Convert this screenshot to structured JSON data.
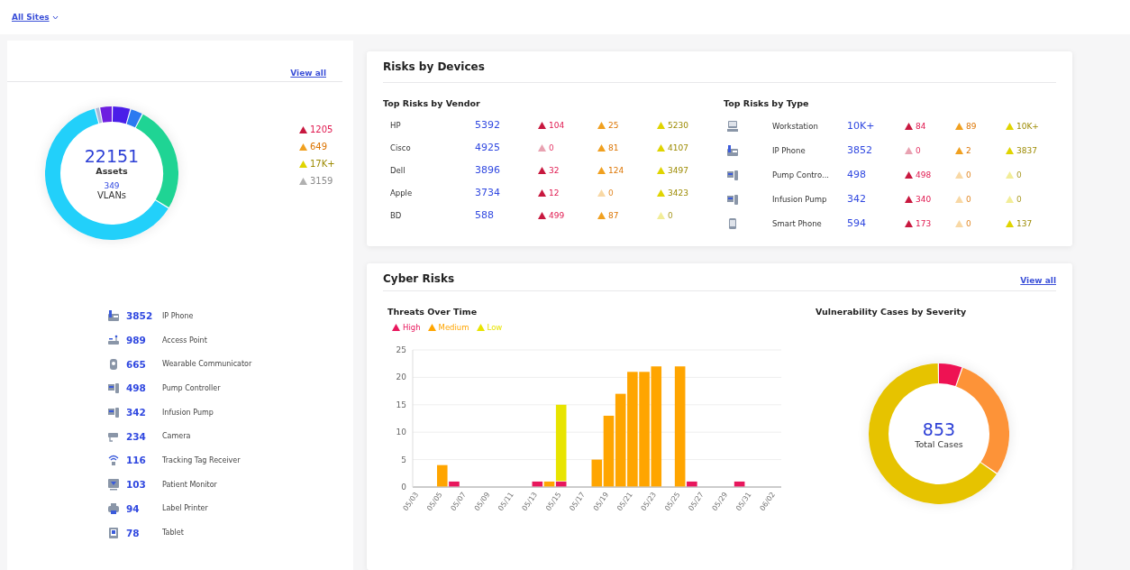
{
  "top_bar": {
    "site_filter": "All Sites"
  },
  "assets": {
    "view_all": "View all",
    "total": "22151",
    "total_label": "Assets",
    "vlans": "349",
    "vlans_label": "VLANs",
    "risks": [
      {
        "kind": "high",
        "count": "1205"
      },
      {
        "kind": "medium",
        "count": "649"
      },
      {
        "kind": "low",
        "count": "17K+"
      },
      {
        "kind": "none",
        "count": "3159"
      }
    ],
    "devices": [
      {
        "kind": "ip-phone",
        "count": "3852",
        "name": "IP Phone"
      },
      {
        "kind": "access-point",
        "count": "989",
        "name": "Access Point"
      },
      {
        "kind": "wearable",
        "count": "665",
        "name": "Wearable Communicator"
      },
      {
        "kind": "pump",
        "count": "498",
        "name": "Pump Controller"
      },
      {
        "kind": "pump",
        "count": "342",
        "name": "Infusion Pump"
      },
      {
        "kind": "camera",
        "count": "234",
        "name": "Camera"
      },
      {
        "kind": "tracking-tag",
        "count": "116",
        "name": "Tracking Tag Receiver"
      },
      {
        "kind": "patient-monitor",
        "count": "103",
        "name": "Patient Monitor"
      },
      {
        "kind": "label-printer",
        "count": "94",
        "name": "Label Printer"
      },
      {
        "kind": "tablet",
        "count": "78",
        "name": "Tablet"
      }
    ]
  },
  "risks_by_devices": {
    "title": "Risks by Devices",
    "vendor_table": {
      "title": "Top Risks by Vendor",
      "rows": [
        {
          "name": "HP",
          "count": "5392",
          "risks": [
            {
              "kind": "high",
              "count": "104",
              "faded": false
            },
            {
              "kind": "medium",
              "count": "25",
              "faded": false
            },
            {
              "kind": "low",
              "count": "5230",
              "faded": false
            }
          ]
        },
        {
          "name": "Cisco",
          "count": "4925",
          "risks": [
            {
              "kind": "high",
              "count": "0",
              "faded": true
            },
            {
              "kind": "medium",
              "count": "81",
              "faded": false
            },
            {
              "kind": "low",
              "count": "4107",
              "faded": false
            }
          ]
        },
        {
          "name": "Dell",
          "count": "3896",
          "risks": [
            {
              "kind": "high",
              "count": "32",
              "faded": false
            },
            {
              "kind": "medium",
              "count": "124",
              "faded": false
            },
            {
              "kind": "low",
              "count": "3497",
              "faded": false
            }
          ]
        },
        {
          "name": "Apple",
          "count": "3734",
          "risks": [
            {
              "kind": "high",
              "count": "12",
              "faded": false
            },
            {
              "kind": "medium",
              "count": "0",
              "faded": true
            },
            {
              "kind": "low",
              "count": "3423",
              "faded": false
            }
          ]
        },
        {
          "name": "BD",
          "count": "588",
          "risks": [
            {
              "kind": "high",
              "count": "499",
              "faded": false
            },
            {
              "kind": "medium",
              "count": "87",
              "faded": false
            },
            {
              "kind": "low",
              "count": "0",
              "faded": true
            }
          ]
        }
      ]
    },
    "type_table": {
      "title": "Top Risks by Type",
      "rows": [
        {
          "kind": "workstation",
          "name": "Workstation",
          "count": "10K+",
          "risks": [
            {
              "kind": "high",
              "count": "84",
              "faded": false
            },
            {
              "kind": "medium",
              "count": "89",
              "faded": false
            },
            {
              "kind": "low",
              "count": "10K+",
              "faded": false
            }
          ]
        },
        {
          "kind": "ip-phone",
          "name": "IP Phone",
          "count": "3852",
          "risks": [
            {
              "kind": "high",
              "count": "0",
              "faded": true
            },
            {
              "kind": "medium",
              "count": "2",
              "faded": false
            },
            {
              "kind": "low",
              "count": "3837",
              "faded": false
            }
          ]
        },
        {
          "kind": "pump",
          "name": "Pump Contro...",
          "count": "498",
          "risks": [
            {
              "kind": "high",
              "count": "498",
              "faded": false
            },
            {
              "kind": "medium",
              "count": "0",
              "faded": true
            },
            {
              "kind": "low",
              "count": "0",
              "faded": true
            }
          ]
        },
        {
          "kind": "pump",
          "name": "Infusion Pump",
          "count": "342",
          "risks": [
            {
              "kind": "high",
              "count": "340",
              "faded": false
            },
            {
              "kind": "medium",
              "count": "0",
              "faded": true
            },
            {
              "kind": "low",
              "count": "0",
              "faded": true
            }
          ]
        },
        {
          "kind": "smart-phone",
          "name": "Smart Phone",
          "count": "594",
          "risks": [
            {
              "kind": "high",
              "count": "173",
              "faded": false
            },
            {
              "kind": "medium",
              "count": "0",
              "faded": true
            },
            {
              "kind": "low",
              "count": "137",
              "faded": false
            }
          ]
        }
      ]
    }
  },
  "cyber_risks": {
    "title": "Cyber Risks",
    "view_all": "View all",
    "threats": {
      "title": "Threats Over Time",
      "chart_data": {
        "type": "bar",
        "stacked": true,
        "grid": true,
        "categories": [
          "05/03",
          null,
          "05/05",
          null,
          "05/07",
          null,
          "05/09",
          null,
          "05/11",
          null,
          "05/13",
          null,
          "05/15",
          null,
          "05/17",
          null,
          "05/19",
          null,
          "05/21",
          null,
          "05/23",
          null,
          "05/25",
          null,
          "05/27",
          null,
          "05/29",
          null,
          "05/31",
          null,
          "06/02"
        ],
        "series": [
          {
            "name": "High",
            "color": "#e8175d",
            "values": [
              0,
              0,
              0,
              1,
              0,
              0,
              0,
              0,
              0,
              0,
              1,
              0,
              1,
              0,
              0,
              0,
              0,
              0,
              0,
              0,
              0,
              0,
              0,
              1,
              0,
              0,
              0,
              1,
              0,
              0,
              0
            ]
          },
          {
            "name": "Medium",
            "color": "#ffa500",
            "values": [
              0,
              0,
              4,
              0,
              0,
              0,
              0,
              0,
              0,
              0,
              0,
              1,
              0,
              0,
              0,
              5,
              13,
              17,
              21,
              21,
              22,
              0,
              22,
              0,
              0,
              0,
              0,
              0,
              0,
              0,
              0
            ]
          },
          {
            "name": "Low",
            "color": "#e8e400",
            "values": [
              0,
              0,
              0,
              0,
              0,
              0,
              0,
              0,
              0,
              0,
              0,
              0,
              14,
              0,
              0,
              0,
              0,
              0,
              0,
              0,
              0,
              0,
              0,
              0,
              0,
              0,
              0,
              0,
              0,
              0,
              0
            ]
          }
        ],
        "ylim": [
          0,
          25
        ],
        "yticks": [
          0,
          5,
          10,
          15,
          20,
          25
        ]
      }
    },
    "vulnerabilities": {
      "title": "Vulnerability Cases by Severity",
      "total": "853",
      "total_label": "Total Cases"
    }
  }
}
